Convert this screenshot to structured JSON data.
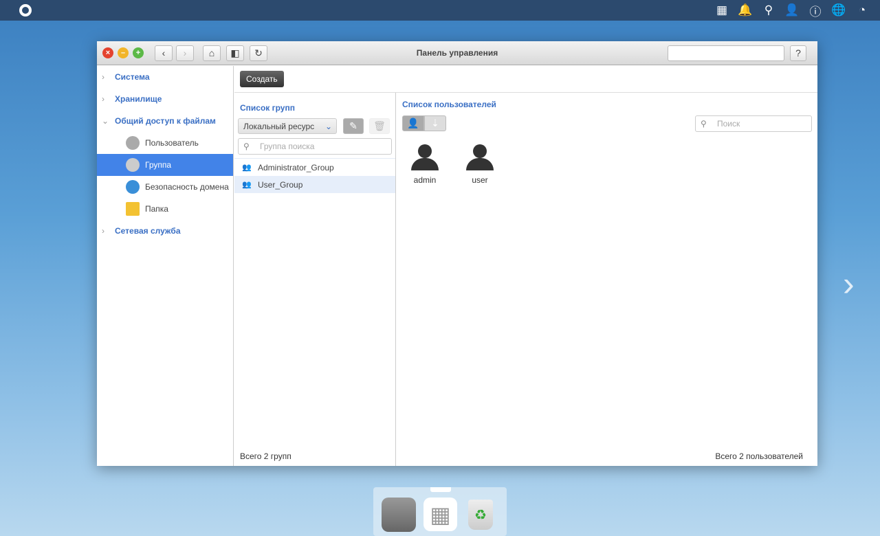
{
  "window": {
    "title": "Панель управления"
  },
  "sidebar": {
    "items": [
      {
        "label": "Система"
      },
      {
        "label": "Хранилище"
      },
      {
        "label": "Общий доступ к файлам"
      },
      {
        "label": "Сетевая служба"
      }
    ],
    "sub_items": [
      {
        "label": "Пользователь"
      },
      {
        "label": "Группа"
      },
      {
        "label": "Безопасность домена"
      },
      {
        "label": "Папка"
      }
    ]
  },
  "toolbar": {
    "create_label": "Создать"
  },
  "groups": {
    "title": "Список групп",
    "source": "Локальный ресурс",
    "search_placeholder": "Группа поиска",
    "items": [
      "Administrator_Group",
      "User_Group"
    ],
    "total": "Всего 2 групп"
  },
  "users": {
    "title": "Список пользователей",
    "search_placeholder": "Поиск",
    "items": [
      "admin",
      "user"
    ],
    "total": "Всего 2 пользователей"
  }
}
